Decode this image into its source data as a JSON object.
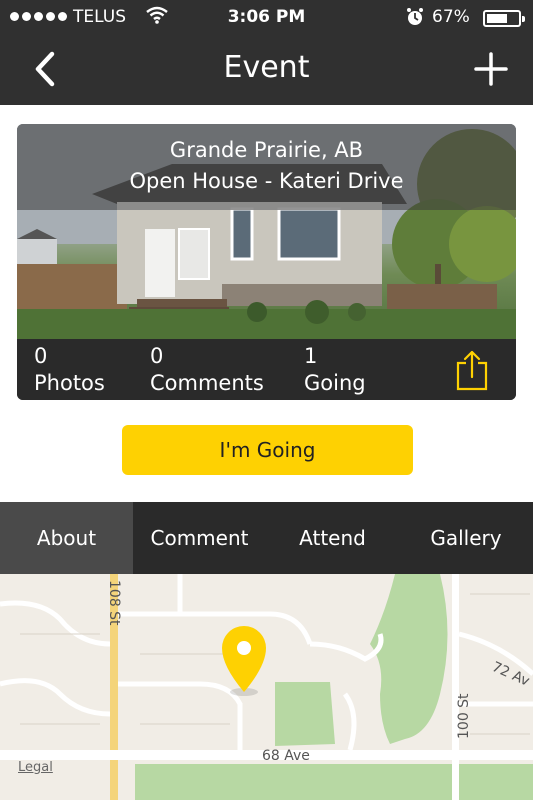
{
  "status_bar": {
    "carrier": "TELUS",
    "time": "3:06 PM",
    "battery_percent": "67%",
    "battery_level": 0.67,
    "icons": [
      "signal-dots-icon",
      "wifi-icon",
      "alarm-icon",
      "battery-icon"
    ]
  },
  "nav": {
    "title": "Event",
    "back_icon": "chevron-left-icon",
    "add_icon": "plus-icon"
  },
  "event": {
    "location": "Grande Prairie, AB",
    "title": "Open House - Kateri Drive",
    "stats": [
      {
        "count": "0",
        "label": "Photos"
      },
      {
        "count": "0",
        "label": "Comments"
      },
      {
        "count": "1",
        "label": "Going"
      }
    ],
    "share_icon": "share-icon"
  },
  "actions": {
    "going_label": "I'm Going"
  },
  "tabs": [
    {
      "label": "About",
      "active": true
    },
    {
      "label": "Comment",
      "active": false
    },
    {
      "label": "Attend",
      "active": false
    },
    {
      "label": "Gallery",
      "active": false
    }
  ],
  "map": {
    "street_labels": [
      "108 St",
      "72 Av",
      "100 St",
      "68 Ave"
    ],
    "legal_label": "Legal",
    "pin_color": "#fed102"
  },
  "colors": {
    "accent": "#fed102",
    "bar": "#303030",
    "active_tab": "#4a4a4a"
  }
}
